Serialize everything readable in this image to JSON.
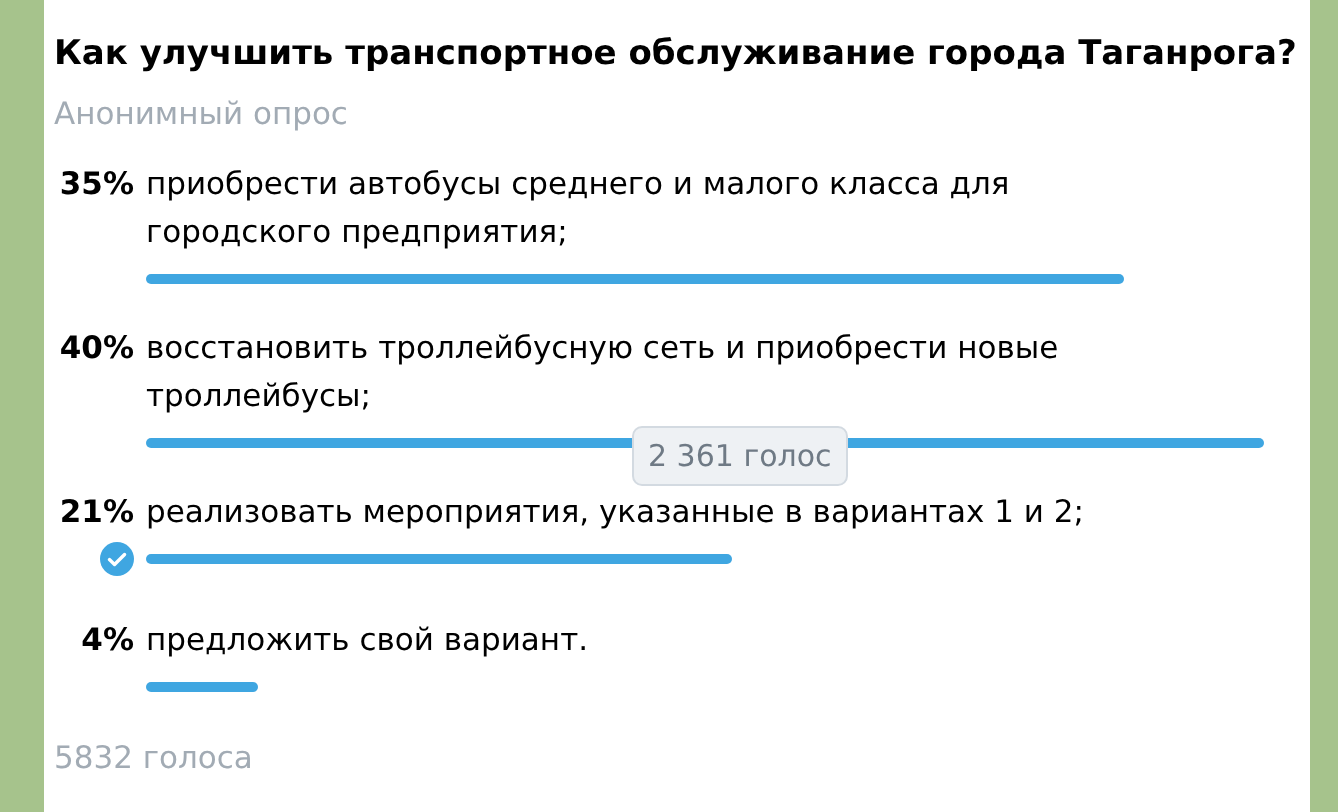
{
  "poll": {
    "question": "Как улучшить транспортное обслуживание города Таганрога?",
    "type_label": "Анонимный опрос",
    "options": [
      {
        "percent": "35%",
        "text": "приобрести автобусы среднего и малого класса для городского предприятия;",
        "selected": false
      },
      {
        "percent": "40%",
        "text": "восстановить троллейбусную сеть и приобрести новые троллейбусы;",
        "selected": false,
        "tooltip": "2 361 голос"
      },
      {
        "percent": "21%",
        "text": "реализовать мероприятия, указанные в вариантах 1 и 2;",
        "selected": true
      },
      {
        "percent": "4%",
        "text": "предложить свой вариант.",
        "selected": false
      }
    ],
    "total": "5832 голоса"
  }
}
